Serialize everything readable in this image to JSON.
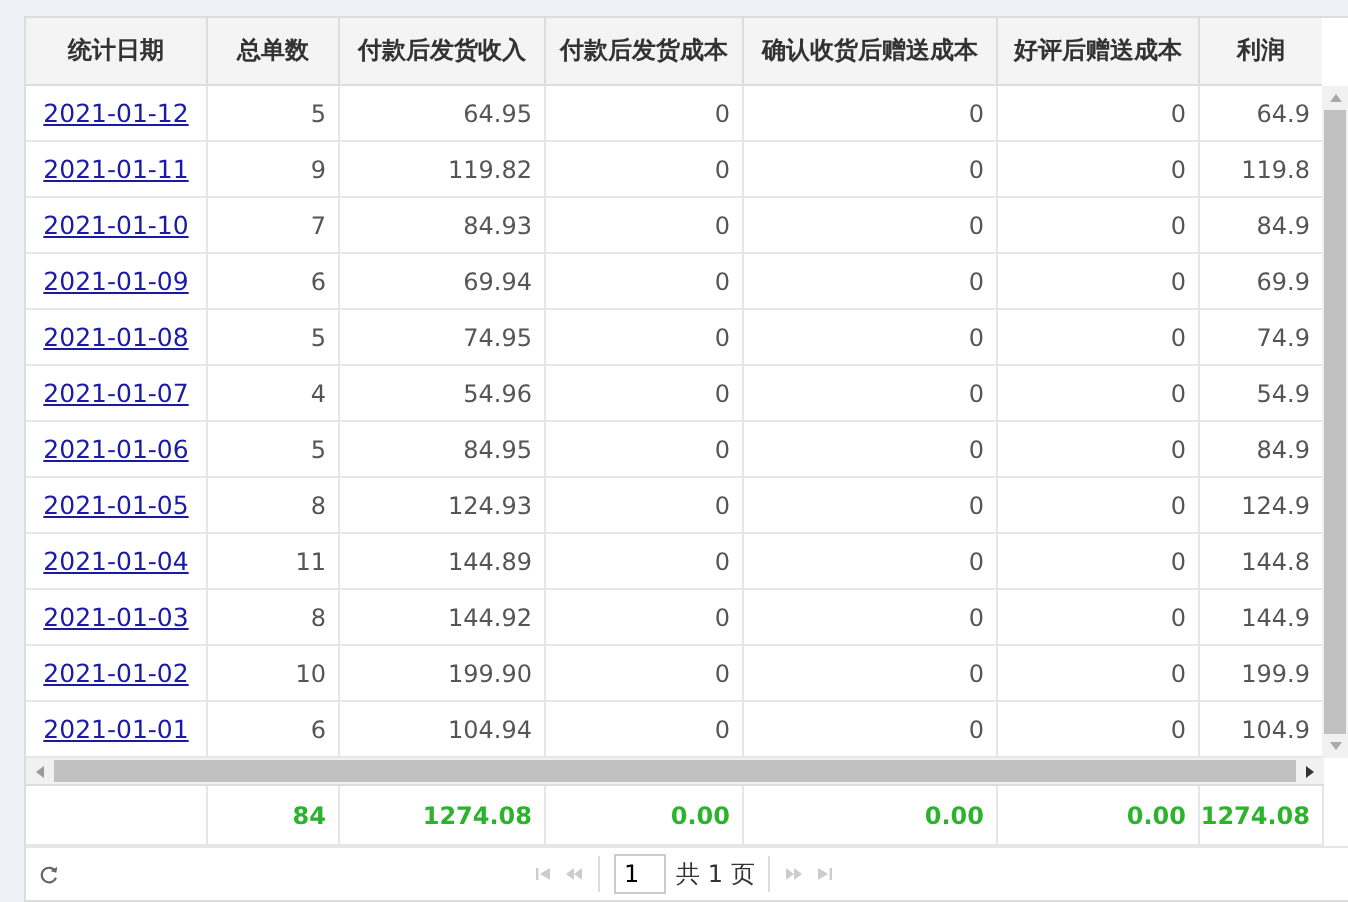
{
  "table": {
    "columns": [
      "统计日期",
      "总单数",
      "付款后发货收入",
      "付款后发货成本",
      "确认收货后赠送成本",
      "好评后赠送成本",
      "利润"
    ],
    "rows": [
      {
        "cells": [
          "2021-01-12",
          "5",
          "64.95",
          "0",
          "0",
          "0",
          "64.9"
        ]
      },
      {
        "cells": [
          "2021-01-11",
          "9",
          "119.82",
          "0",
          "0",
          "0",
          "119.8"
        ]
      },
      {
        "cells": [
          "2021-01-10",
          "7",
          "84.93",
          "0",
          "0",
          "0",
          "84.9"
        ]
      },
      {
        "cells": [
          "2021-01-09",
          "6",
          "69.94",
          "0",
          "0",
          "0",
          "69.9"
        ]
      },
      {
        "cells": [
          "2021-01-08",
          "5",
          "74.95",
          "0",
          "0",
          "0",
          "74.9"
        ]
      },
      {
        "cells": [
          "2021-01-07",
          "4",
          "54.96",
          "0",
          "0",
          "0",
          "54.9"
        ]
      },
      {
        "cells": [
          "2021-01-06",
          "5",
          "84.95",
          "0",
          "0",
          "0",
          "84.9"
        ]
      },
      {
        "cells": [
          "2021-01-05",
          "8",
          "124.93",
          "0",
          "0",
          "0",
          "124.9"
        ]
      },
      {
        "cells": [
          "2021-01-04",
          "11",
          "144.89",
          "0",
          "0",
          "0",
          "144.8"
        ]
      },
      {
        "cells": [
          "2021-01-03",
          "8",
          "144.92",
          "0",
          "0",
          "0",
          "144.9"
        ]
      },
      {
        "cells": [
          "2021-01-02",
          "10",
          "199.90",
          "0",
          "0",
          "0",
          "199.9"
        ]
      },
      {
        "cells": [
          "2021-01-01",
          "6",
          "104.94",
          "0",
          "0",
          "0",
          "104.9"
        ]
      }
    ],
    "totals": [
      "84",
      "1274.08",
      "0.00",
      "0.00",
      "0.00",
      "1274.08"
    ]
  },
  "pager": {
    "page": "1",
    "total_label": "共 1 页"
  }
}
